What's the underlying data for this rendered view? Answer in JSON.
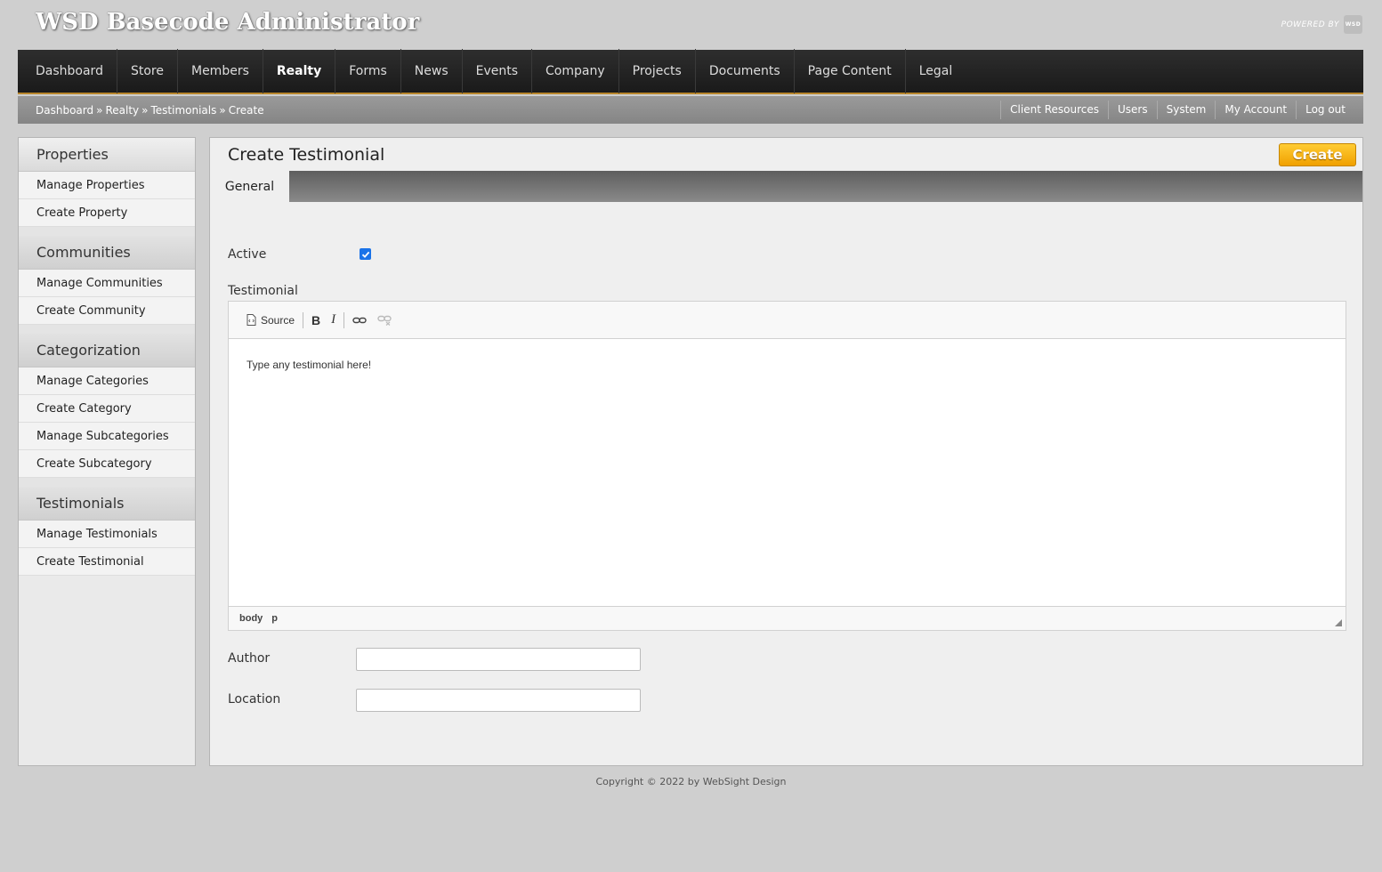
{
  "app": {
    "title": "WSD Basecode Administrator",
    "powered_by": "POWERED BY",
    "logo_text": "WSD"
  },
  "nav": {
    "items": [
      "Dashboard",
      "Store",
      "Members",
      "Realty",
      "Forms",
      "News",
      "Events",
      "Company",
      "Projects",
      "Documents",
      "Page Content",
      "Legal"
    ],
    "active": "Realty"
  },
  "breadcrumb": {
    "items": [
      "Dashboard",
      "Realty",
      "Testimonials",
      "Create"
    ],
    "separator": "»"
  },
  "utility_links": [
    "Client Resources",
    "Users",
    "System",
    "My Account",
    "Log out"
  ],
  "sidebar": {
    "sections": [
      {
        "heading": "Properties",
        "links": [
          "Manage Properties",
          "Create Property"
        ]
      },
      {
        "heading": "Communities",
        "links": [
          "Manage Communities",
          "Create Community"
        ]
      },
      {
        "heading": "Categorization",
        "links": [
          "Manage Categories",
          "Create Category",
          "Manage Subcategories",
          "Create Subcategory"
        ]
      },
      {
        "heading": "Testimonials",
        "links": [
          "Manage Testimonials",
          "Create Testimonial"
        ]
      }
    ]
  },
  "main": {
    "title": "Create Testimonial",
    "create_button": "Create",
    "tabs": [
      "General"
    ],
    "form": {
      "active_label": "Active",
      "active_checked": true,
      "testimonial_label": "Testimonial",
      "author_label": "Author",
      "author_value": "",
      "location_label": "Location",
      "location_value": ""
    },
    "editor": {
      "source_label": "Source",
      "bold_label": "B",
      "italic_label": "I",
      "content": "Type any testimonial here!",
      "status_path": [
        "body",
        "p"
      ]
    }
  },
  "footer": {
    "text": "Copyright © 2022 by WebSight Design"
  },
  "colors": {
    "accent": "#f0a000",
    "nav_bg": "#1a1a1a",
    "nav_border": "#b8862b",
    "checkbox": "#1a73e8"
  }
}
